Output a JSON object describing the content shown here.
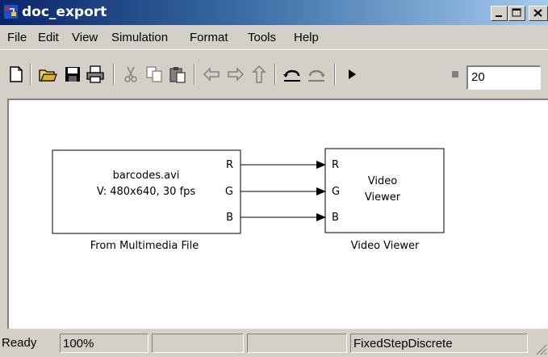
{
  "window": {
    "title": "doc_export"
  },
  "menu": [
    "File",
    "Edit",
    "View",
    "Simulation",
    "Format",
    "Tools",
    "Help"
  ],
  "toolbar": {
    "stop_time": "20"
  },
  "blocks": {
    "source": {
      "line1": "barcodes.avi",
      "line2": "V: 480x640, 30 fps",
      "ports": [
        "R",
        "G",
        "B"
      ],
      "caption": "From Multimedia File"
    },
    "viewer": {
      "line1": "Video",
      "line2": "Viewer",
      "ports": [
        "R",
        "G",
        "B"
      ],
      "caption": "Video Viewer"
    }
  },
  "status": {
    "state": "Ready",
    "zoom": "100%",
    "solver": "FixedStepDiscrete"
  }
}
